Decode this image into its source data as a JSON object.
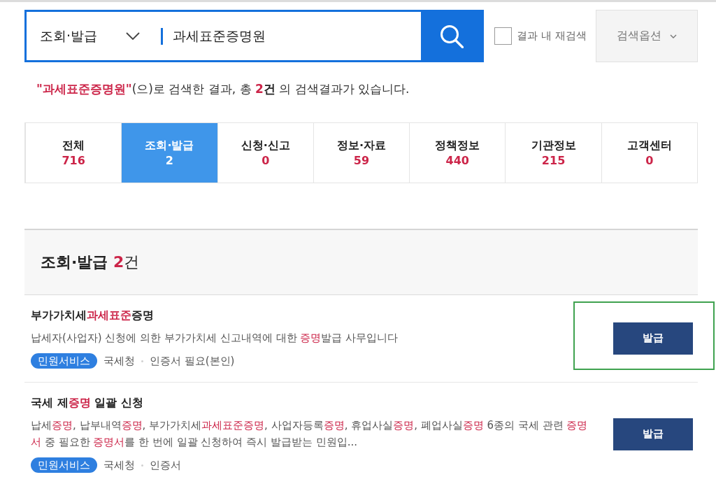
{
  "search": {
    "scope": "조회·발급",
    "query": "과세표준증명원",
    "refine": {
      "label": "결과 내 재검색",
      "checked": false
    },
    "options_button": "검색옵션"
  },
  "summary": [
    {
      "text": "\"과세표준증명원\"",
      "bold": true,
      "highlight": true
    },
    {
      "text": "(으)로 검색한 결과, 총 ",
      "bold": false,
      "highlight": false
    },
    {
      "text": "2",
      "bold": true,
      "highlight": true
    },
    {
      "text": "건",
      "bold": true,
      "highlight": false
    },
    {
      "text": " 의 검색결과가 있습니다.",
      "bold": false,
      "highlight": false
    }
  ],
  "tabs": [
    {
      "label": "전체",
      "count": "716",
      "selected": false
    },
    {
      "label": "조회·발급",
      "count": "2",
      "selected": true
    },
    {
      "label": "신청·신고",
      "count": "0",
      "selected": false
    },
    {
      "label": "정보·자료",
      "count": "59",
      "selected": false
    },
    {
      "label": "정책정보",
      "count": "440",
      "selected": false
    },
    {
      "label": "기관정보",
      "count": "215",
      "selected": false
    },
    {
      "label": "고객센터",
      "count": "0",
      "selected": false
    }
  ],
  "section": {
    "title": [
      {
        "text": "조회·발급 ",
        "bold": true,
        "highlight": false
      },
      {
        "text": "2",
        "bold": true,
        "highlight": true
      },
      {
        "text": "건",
        "bold": false,
        "highlight": false
      }
    ],
    "items": [
      {
        "title": [
          {
            "text": "부가가치세",
            "highlight": false
          },
          {
            "text": "과세표준",
            "highlight": true
          },
          {
            "text": "증명",
            "highlight": false
          }
        ],
        "description": [
          {
            "text": "납세자(사업자) 신청에 의한 부가가치세 신고내역에 대한 ",
            "highlight": false
          },
          {
            "text": "증명",
            "highlight": true
          },
          {
            "text": "발급 사무입니다",
            "highlight": false
          }
        ],
        "tags": [
          {
            "label": "민원서비스",
            "kind": "badge"
          },
          {
            "label": "국세청",
            "kind": "text"
          },
          {
            "label": "인증서 필요(본인)",
            "kind": "text"
          }
        ],
        "button": "발급",
        "highlighted": true
      },
      {
        "title": [
          {
            "text": "국세 제",
            "highlight": false
          },
          {
            "text": "증명",
            "highlight": true
          },
          {
            "text": " 일괄 신청",
            "highlight": false
          }
        ],
        "description": [
          {
            "text": "납세",
            "highlight": false
          },
          {
            "text": "증명",
            "highlight": true
          },
          {
            "text": ", 납부내역",
            "highlight": false
          },
          {
            "text": "증명",
            "highlight": true
          },
          {
            "text": ", 부가가치세",
            "highlight": false
          },
          {
            "text": "과세표준증명",
            "highlight": true
          },
          {
            "text": ", 사업자등록",
            "highlight": false
          },
          {
            "text": "증명",
            "highlight": true
          },
          {
            "text": ", 휴업사실",
            "highlight": false
          },
          {
            "text": "증명",
            "highlight": true
          },
          {
            "text": ", 폐업사실",
            "highlight": false
          },
          {
            "text": "증명",
            "highlight": true
          },
          {
            "text": " 6종의 국세 관련 ",
            "highlight": false
          },
          {
            "text": "증명서",
            "highlight": true
          },
          {
            "text": " 중 필요한 ",
            "highlight": false
          },
          {
            "text": "증명서",
            "highlight": true
          },
          {
            "text": "를 한 번에 일괄 신청하여 즉시 발급받는 민원입...",
            "highlight": false
          }
        ],
        "tags": [
          {
            "label": "민원서비스",
            "kind": "badge"
          },
          {
            "label": "국세청",
            "kind": "text"
          },
          {
            "label": "인증서",
            "kind": "text"
          }
        ],
        "button": "발급",
        "highlighted": false
      }
    ]
  }
}
